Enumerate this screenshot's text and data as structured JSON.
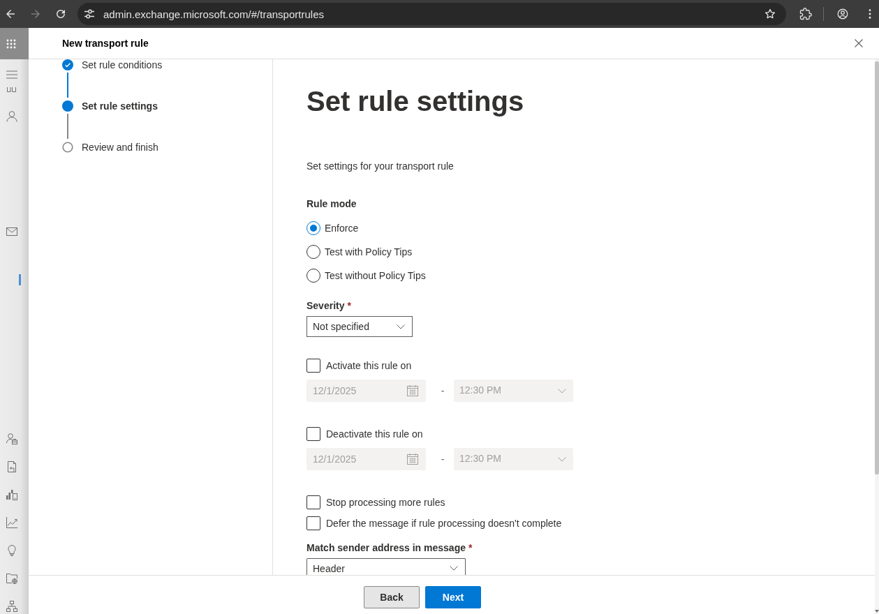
{
  "browser": {
    "url": "admin.exchange.microsoft.com/#/transportrules",
    "forward_disabled": true
  },
  "panel": {
    "title": "New transport rule"
  },
  "steps": [
    {
      "label": "Set rule conditions",
      "completed": true,
      "selected": false
    },
    {
      "label": "Set rule settings",
      "completed": false,
      "selected": true
    },
    {
      "label": "Review and finish",
      "completed": false,
      "selected": false
    }
  ],
  "content": {
    "heading": "Set rule settings",
    "description": "Set settings for your transport rule"
  },
  "rule_mode": {
    "label": "Rule mode",
    "options": [
      {
        "label": "Enforce",
        "selected": true
      },
      {
        "label": "Test with Policy Tips",
        "selected": false
      },
      {
        "label": "Test without Policy Tips",
        "selected": false
      }
    ]
  },
  "severity": {
    "label": "Severity",
    "required_mark": "*",
    "value": "Not specified"
  },
  "schedule": [
    {
      "label": "Activate this rule on",
      "checked": false,
      "date": "12/1/2025",
      "separator": "-",
      "time": "12:30 PM",
      "disabled": true
    },
    {
      "label": "Deactivate this rule on",
      "checked": false,
      "date": "12/1/2025",
      "separator": "-",
      "time": "12:30 PM",
      "disabled": true
    }
  ],
  "options": [
    {
      "label": "Stop processing more rules",
      "checked": false
    },
    {
      "label": "Defer the message if rule processing doesn't complete",
      "checked": false
    }
  ],
  "match_sender": {
    "label": "Match sender address in message",
    "required_mark": "*",
    "value": "Header"
  },
  "footer": {
    "buttons": [
      {
        "label": "Back",
        "kind": "secondary"
      },
      {
        "label": "Next",
        "kind": "primary"
      }
    ]
  }
}
